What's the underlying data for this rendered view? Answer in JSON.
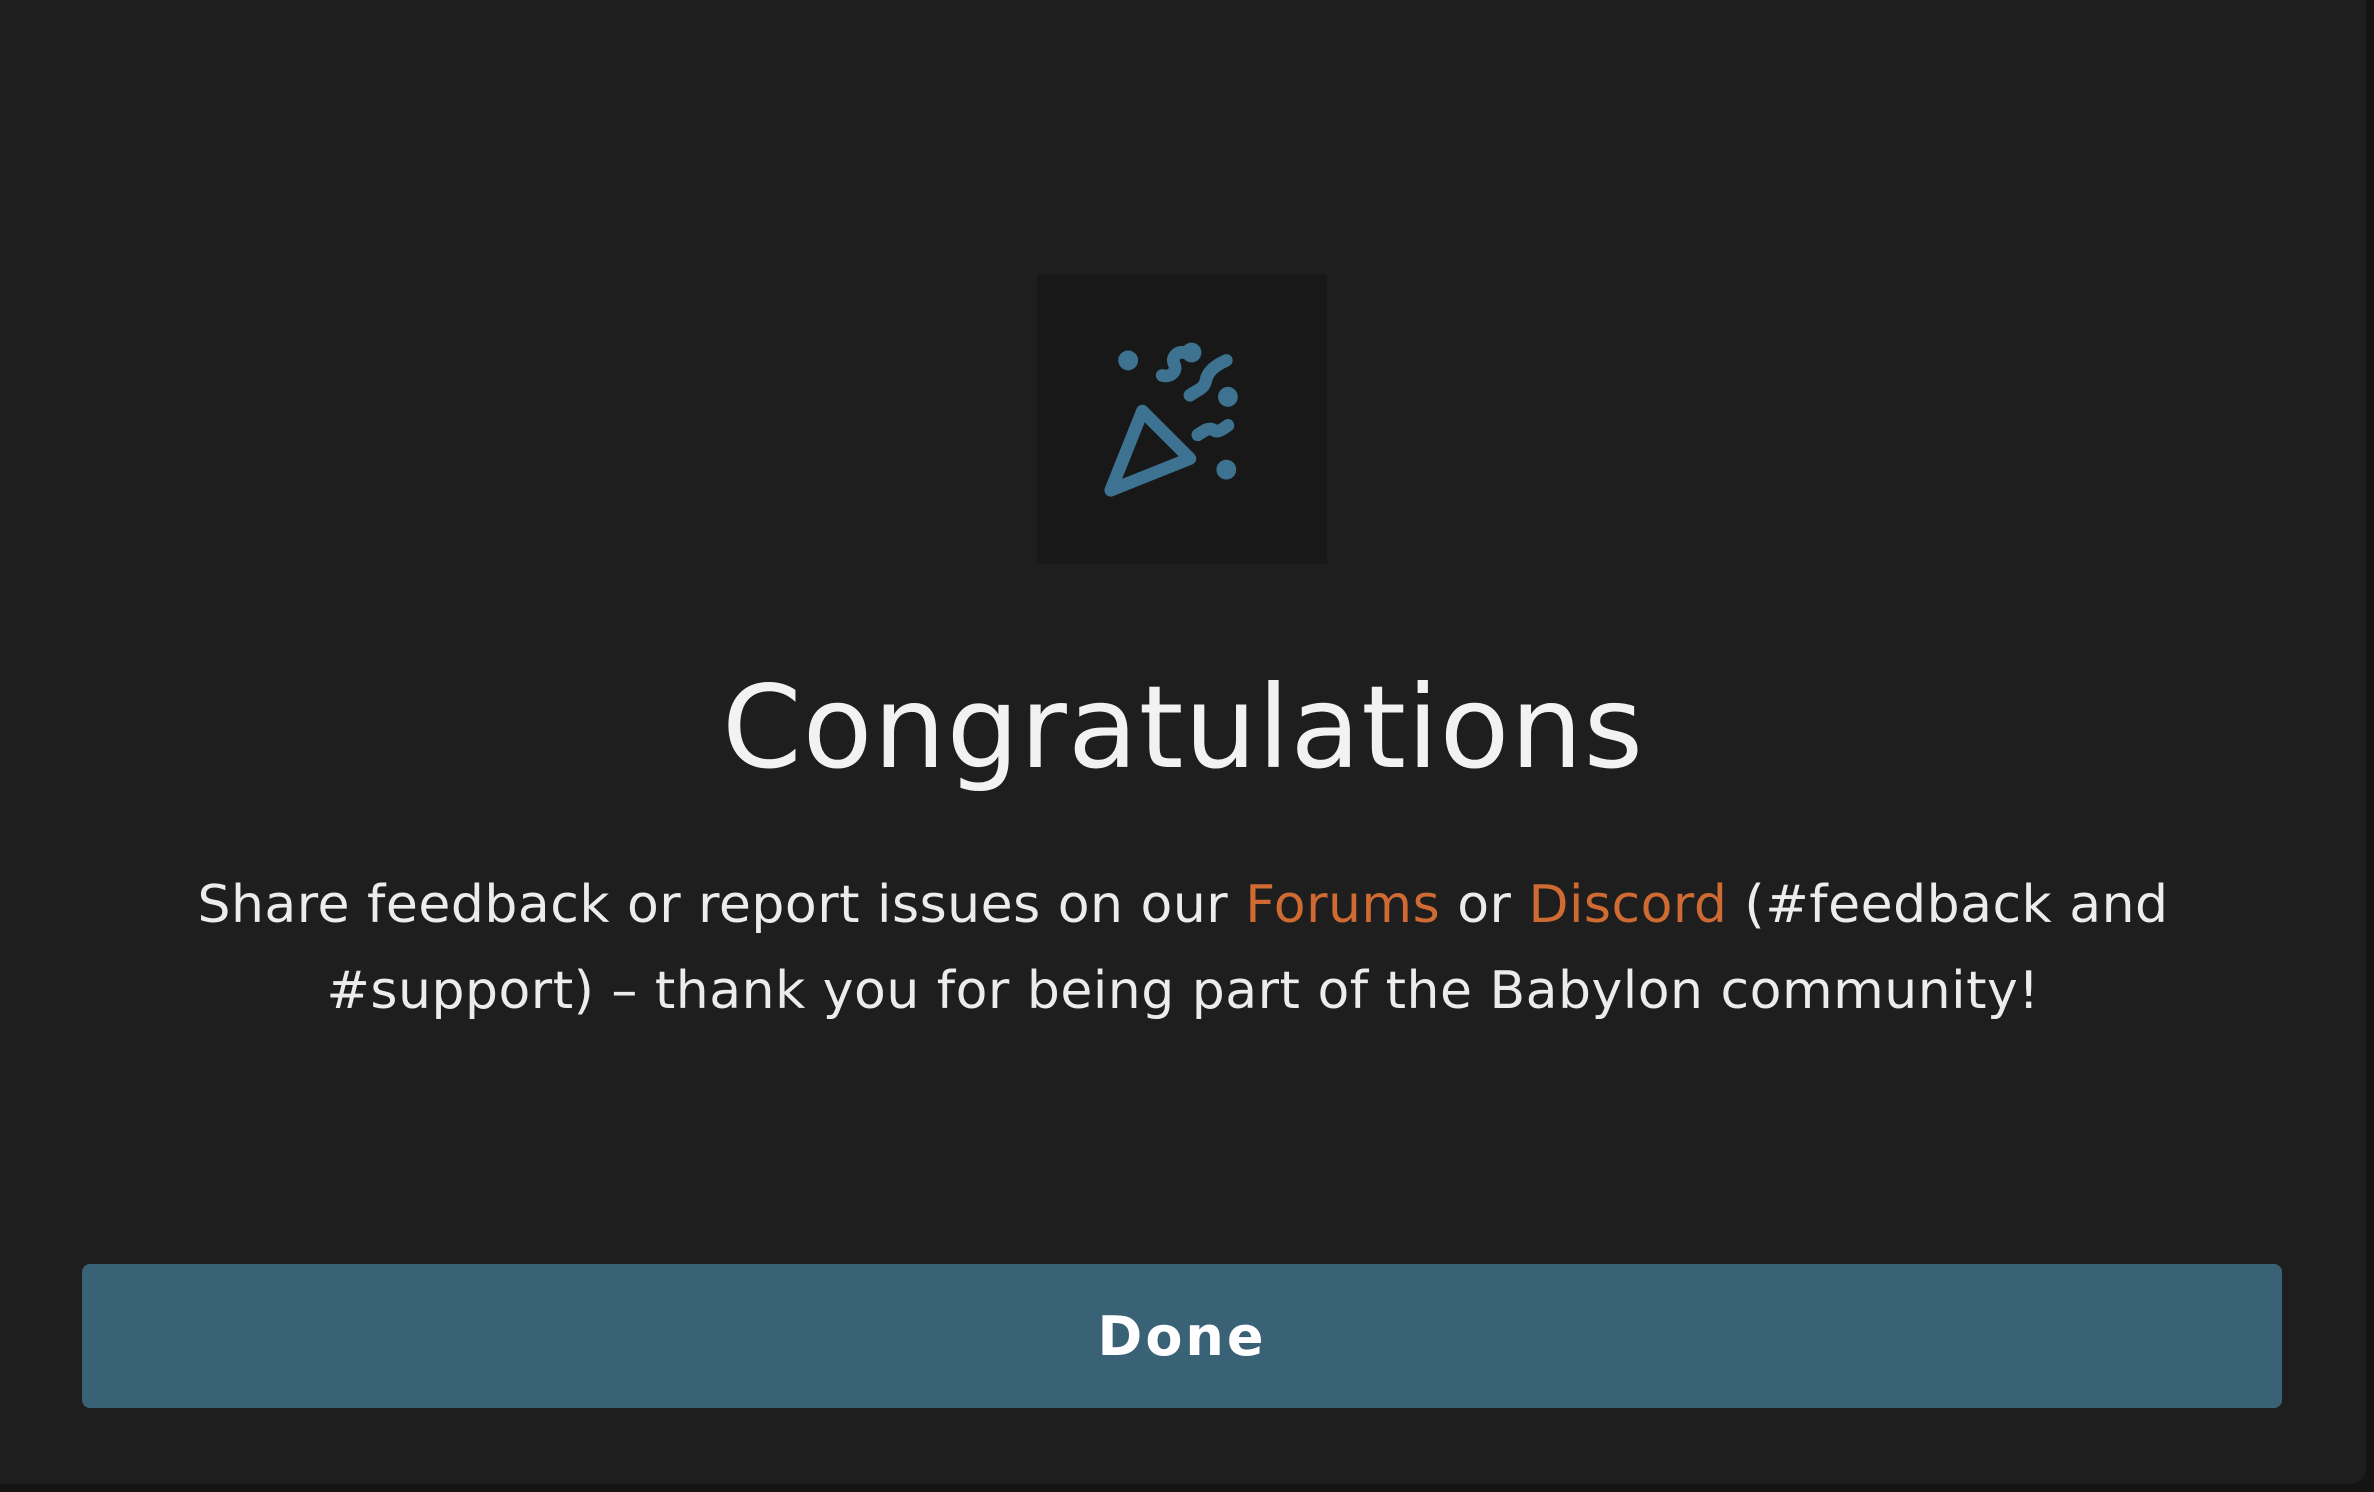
{
  "dialog": {
    "icon": "party-popper-icon",
    "title": "Congratulations",
    "message": {
      "part1": "Share feedback or report issues on our ",
      "link_forums": "Forums",
      "part2": " or ",
      "link_discord": "Discord",
      "part3": " (#feedback and #support) – thank you for being part of the Babylon community!"
    },
    "done_label": "Done"
  },
  "colors": {
    "background": "#1e1e1f",
    "icon_box": "#181818",
    "icon": "#3d7390",
    "link": "#cf6a32",
    "button": "#3a6277",
    "text": "#ececec"
  }
}
